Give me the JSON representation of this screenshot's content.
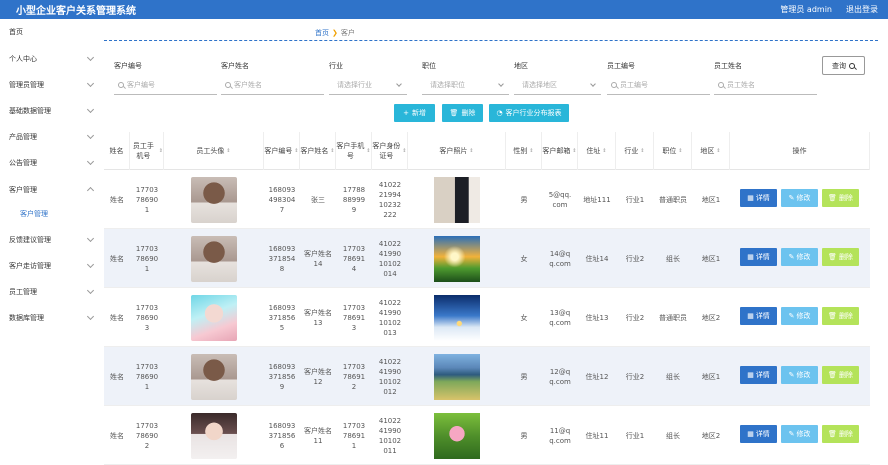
{
  "app": {
    "title": "小型企业客户关系管理系统",
    "user": "管理员 admin",
    "logout": "退出登录"
  },
  "sidebar": {
    "items": [
      {
        "label": "首页"
      },
      {
        "label": "个人中心"
      },
      {
        "label": "管理员管理"
      },
      {
        "label": "基础数据管理"
      },
      {
        "label": "产品管理"
      },
      {
        "label": "公告管理"
      },
      {
        "label": "客户管理"
      },
      {
        "label": "客户管理"
      },
      {
        "label": "反馈建议管理"
      },
      {
        "label": "客户走访管理"
      },
      {
        "label": "员工管理"
      },
      {
        "label": "数据库管理"
      }
    ]
  },
  "breadcrumb": {
    "home": "首页",
    "current": "客户"
  },
  "filters": {
    "labels": [
      "客户编号",
      "客户姓名",
      "行业",
      "职位",
      "地区",
      "员工编号",
      "员工姓名"
    ],
    "placeholders": [
      "客户编号",
      "客户姓名",
      "请选择行业",
      "请选择职位",
      "请选择地区",
      "员工编号",
      "员工姓名"
    ],
    "search": "查询"
  },
  "actions": {
    "add": "新增",
    "delete": "删除",
    "report": "客户行业分布报表"
  },
  "table": {
    "headers": [
      "姓名",
      "员工手机号",
      "员工头像",
      "客户编号",
      "客户姓名",
      "客户手机号",
      "客户身份证号",
      "客户照片",
      "性别",
      "客户邮箱",
      "住址",
      "行业",
      "职位",
      "地区",
      "操作"
    ],
    "buttons": {
      "detail": "详情",
      "edit": "修改",
      "delete": "删除"
    },
    "rows": [
      {
        "name": "姓名",
        "emp_phone": "17703786901",
        "cust_no": "1680934983047",
        "cust_name": "张三",
        "cust_phone": "17788889999",
        "id_no": "410222199410232222",
        "gender": "男",
        "email": "5@qq.com",
        "address": "地址111",
        "industry": "行业1",
        "position": "普通职员",
        "region": "地区1"
      },
      {
        "name": "姓名",
        "emp_phone": "17703786901",
        "cust_no": "1680933718548",
        "cust_name": "客户姓名14",
        "cust_phone": "17703786914",
        "id_no": "410224199010102014",
        "gender": "女",
        "email": "14@qq.com",
        "address": "住址14",
        "industry": "行业2",
        "position": "组长",
        "region": "地区1"
      },
      {
        "name": "姓名",
        "emp_phone": "17703786903",
        "cust_no": "1680933718565",
        "cust_name": "客户姓名13",
        "cust_phone": "17703786913",
        "id_no": "410224199010102013",
        "gender": "女",
        "email": "13@qq.com",
        "address": "住址13",
        "industry": "行业2",
        "position": "普通职员",
        "region": "地区2"
      },
      {
        "name": "姓名",
        "emp_phone": "17703786901",
        "cust_no": "1680933718569",
        "cust_name": "客户姓名12",
        "cust_phone": "17703786912",
        "id_no": "410224199010102012",
        "gender": "男",
        "email": "12@qq.com",
        "address": "住址12",
        "industry": "行业2",
        "position": "组长",
        "region": "地区1"
      },
      {
        "name": "姓名",
        "emp_phone": "17703786902",
        "cust_no": "1680933718566",
        "cust_name": "客户姓名11",
        "cust_phone": "17703786911",
        "id_no": "410224199010102011",
        "gender": "男",
        "email": "11@qq.com",
        "address": "住址11",
        "industry": "行业1",
        "position": "组长",
        "region": "地区2"
      }
    ]
  },
  "colors": {
    "primary": "#2f73c9",
    "cyan": "#29b6d9",
    "detail": "#2f73c9",
    "edit": "#6cc3ef",
    "delete": "#b4e35a"
  }
}
